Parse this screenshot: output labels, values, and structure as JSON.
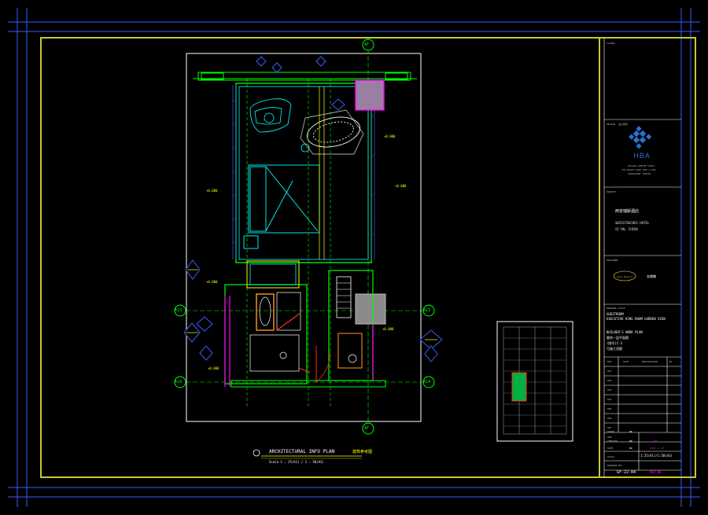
{
  "axes": {
    "top": "AF",
    "bottom": "AF",
    "left_upper": "A13",
    "left_lower": "A14",
    "right_upper": "A13",
    "right_lower": "A14"
  },
  "caption": {
    "title": "ARCHITECTURAL INFO PLAN",
    "title_cn": "建筑参考图",
    "scale": "Scale 1 : 25(A1) / 1 : 50(A3)"
  },
  "title_block": {
    "client_label": "CLIENT",
    "designer_label": "DESIGN",
    "designer_cn": "设计顾问",
    "logo_text": "HBA",
    "logo_sub": [
      "DESIGN CENTRE PARTS",
      "750 BEACH ROAD #09-1 TWO.",
      "SINGAPORE 199588"
    ],
    "project_label": "PROJECT",
    "project_cn": "西安瑞斯酒店",
    "project_name": "SWISSTOUCHES HOTEL",
    "project_city": "XI'AN, CHINA",
    "contractor_label": "DESIGNER",
    "contractor_cn": "金螳螂",
    "contractor_brand": "Gold Mantis",
    "drawing_label": "DRAWING TITLE",
    "drawing_title": [
      "GUESTROOM",
      "EXECUTIVE KING ROOM GARDEN VIEW",
      "BUILDER'S WORK PLAN",
      "客房一层平面图",
      "(图号)C-3",
      "可施工用图"
    ],
    "rev_headers": [
      "REV",
      "DATE",
      "DESCRIPTION",
      "BY"
    ],
    "rev_rows": [
      "001",
      "002",
      "003",
      "004",
      "005",
      "006",
      "007",
      "008"
    ],
    "fields": [
      {
        "label": "DRAWN",
        "value": "HR"
      },
      {
        "label": "CHECKED",
        "value": "BR",
        "extra": "设计"
      },
      {
        "label": "DATE",
        "value": "BR",
        "extra": "2009.11.26"
      },
      {
        "label": "SCALE",
        "value": "1:25(A1)/1:50(A3)"
      },
      {
        "label": "DRAWING NO.",
        "value": "GF-22-04",
        "extra": "REV NO."
      }
    ]
  },
  "colors": {
    "border": "#c8c830",
    "wall": "#00ff00",
    "cyan": "#00ffff",
    "blue": "#3050ff",
    "magenta": "#ff00ff",
    "yellow": "#ffff00"
  }
}
